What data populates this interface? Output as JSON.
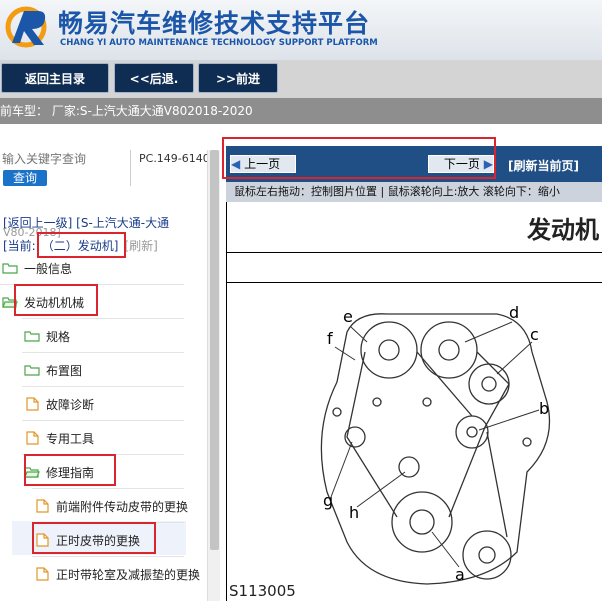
{
  "header": {
    "brand_cn": "畅易汽车维修技术支持平台",
    "brand_en": "CHANG YI AUTO MAINTENANCE TECHNOLOGY SUPPORT PLATFORM"
  },
  "nav": {
    "home": "返回主目录",
    "back": "<<后退.",
    "forward": ">>前进"
  },
  "vehicle_info": "前车型：  厂家:S-上汽大通大通V802018-2020",
  "left": {
    "search_placeholder": "输入关键字查询",
    "search_button": "查询",
    "pc_code": "PC.149-6140",
    "back_link": "[返回上一级]  [S-上汽大通-大通",
    "back_model": "V80-2018]",
    "current_label": "[当前:",
    "current_value": "（二）发动机]",
    "refresh": "[刷新]",
    "tree": [
      {
        "label": "一般信息",
        "icon": "folder-icon"
      },
      {
        "label": "发动机机械",
        "icon": "folder-open-icon"
      },
      {
        "label": "规格",
        "icon": "folder-icon"
      },
      {
        "label": "布置图",
        "icon": "folder-icon"
      },
      {
        "label": "故障诊断",
        "icon": "document-icon"
      },
      {
        "label": "专用工具",
        "icon": "document-icon"
      },
      {
        "label": "修理指南",
        "icon": "folder-open-icon"
      },
      {
        "label": "前端附件传动皮带的更换",
        "icon": "document-icon"
      },
      {
        "label": "正时皮带的更换",
        "icon": "document-icon"
      },
      {
        "label": "正时带轮室及减振垫的更换",
        "icon": "document-icon"
      }
    ]
  },
  "right": {
    "prev_page": "上一页",
    "next_page": "下一页",
    "refresh_page": "[刷新当前页]",
    "hint": "鼠标左右拖动：控制图片位置 | 鼠标滚轮向上:放大  滚轮向下：缩小",
    "doc_title": "发动机",
    "figure_code": "S113005",
    "figure_labels": [
      "e",
      "d",
      "c",
      "f",
      "b",
      "g",
      "h",
      "a"
    ]
  },
  "colors": {
    "brand_blue": "#1b56a8",
    "nav_button": "#0f2d53",
    "highlight_red": "#d9262c",
    "toolbar_blue": "#204f86"
  }
}
